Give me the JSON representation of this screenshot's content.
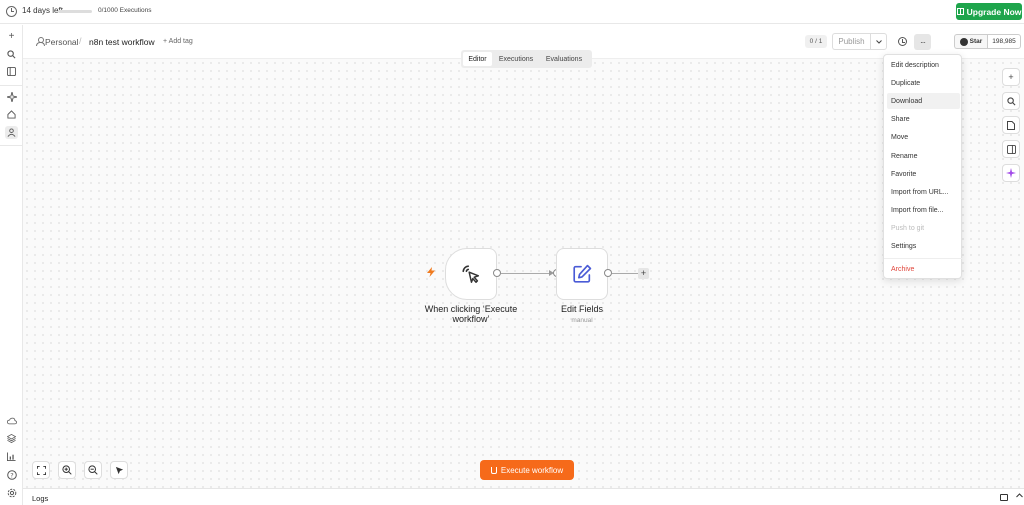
{
  "trial": {
    "days_left": "14 days left",
    "executions": "0/1000 Executions",
    "executions_used_fraction": 0.0,
    "upgrade_label": "Upgrade Now"
  },
  "header": {
    "project": "Personal",
    "separator": "/",
    "workflow_name": "n8n test workflow",
    "add_tag": "+ Add tag",
    "version": "0 / 1",
    "publish_label": "Publish",
    "more_label": "···",
    "github_star_label": "Star",
    "github_star_count": "198,985"
  },
  "tabs": [
    {
      "label": "Editor",
      "active": true
    },
    {
      "label": "Executions",
      "active": false
    },
    {
      "label": "Evaluations",
      "active": false
    }
  ],
  "nodes": {
    "trigger": {
      "label": "When clicking ‘Execute workflow’"
    },
    "edit_fields": {
      "label": "Edit Fields",
      "subtitle": "manual"
    }
  },
  "menu": {
    "items": [
      {
        "label": "Edit description"
      },
      {
        "label": "Duplicate"
      },
      {
        "label": "Download",
        "hover": true
      },
      {
        "label": "Share"
      },
      {
        "label": "Move"
      },
      {
        "label": "Rename"
      },
      {
        "label": "Favorite"
      },
      {
        "label": "Import from URL..."
      },
      {
        "label": "Import from file..."
      },
      {
        "label": "Push to git",
        "disabled": true
      },
      {
        "label": "Settings"
      }
    ],
    "archive_label": "Archive"
  },
  "execute_label": "Execute workflow",
  "logs_label": "Logs",
  "colors": {
    "upgrade": "#1ea54c",
    "execute": "#f66a1a",
    "trigger_bolt": "#f07a1e",
    "edit_icon": "#4a5bd6",
    "archive": "#e0453a"
  }
}
